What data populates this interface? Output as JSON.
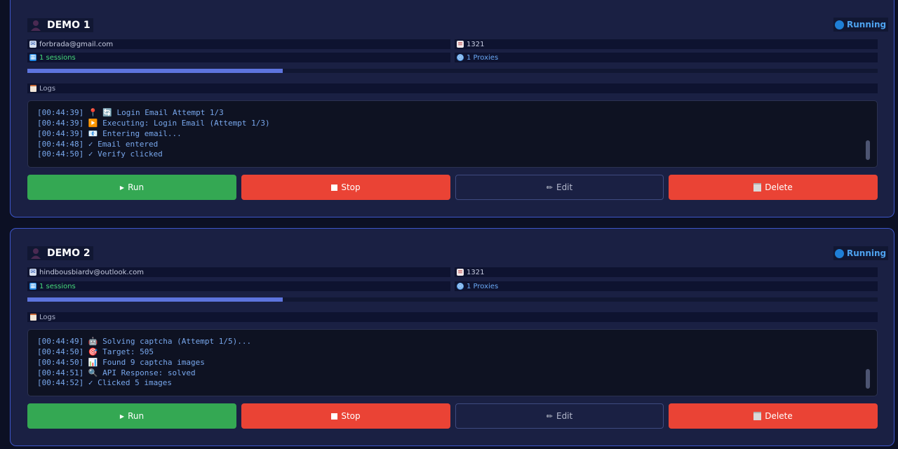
{
  "cards": [
    {
      "title": "DEMO 1",
      "status": "Running",
      "email": "forbrada@gmail.com",
      "code": "1321",
      "sessions": "1 sessions",
      "proxies": "1 Proxies",
      "progress": 0.3,
      "logs_label": "Logs",
      "logs": [
        "[00:44:39] 📍 🔄 Login Email Attempt 1/3",
        "[00:44:39] ▶️ Executing: Login Email (Attempt 1/3)",
        "[00:44:39] 📧 Entering email...",
        "[00:44:48] ✓ Email entered",
        "[00:44:50] ✓ Verify clicked"
      ],
      "buttons": {
        "run": "Run",
        "stop": "Stop",
        "edit": "Edit",
        "delete": "Delete"
      }
    },
    {
      "title": "DEMO 2",
      "status": "Running",
      "email": "hindbousbiardv@outlook.com",
      "code": "1321",
      "sessions": "1 sessions",
      "proxies": "1 Proxies",
      "progress": 0.3,
      "logs_label": "Logs",
      "logs": [
        "[00:44:49] 🤖 Solving captcha (Attempt 1/5)...",
        "[00:44:50] 🎯 Target: 505",
        "[00:44:50] 📊 Found 9 captcha images",
        "[00:44:51] 🔍 API Response: solved",
        "[00:44:52] ✓ Clicked 5 images"
      ],
      "buttons": {
        "run": "Run",
        "stop": "Stop",
        "edit": "Edit",
        "delete": "Delete"
      }
    }
  ],
  "colors": {
    "run": "#34a853",
    "stop": "#ea4335",
    "delete": "#ea4335",
    "status_dot": "#1f7fd6",
    "progress_fill": "#5d74de",
    "card_border": "#3d56c9"
  },
  "icons": {
    "avatar": "user-avatar-icon",
    "status": "status-dot-icon",
    "email": "mail-icon",
    "code": "document-icon",
    "sessions": "sessions-icon",
    "proxies": "globe-icon",
    "logs": "logs-icon",
    "run": "play-icon",
    "stop": "stop-icon",
    "edit": "pencil-icon",
    "delete": "trash-icon"
  }
}
